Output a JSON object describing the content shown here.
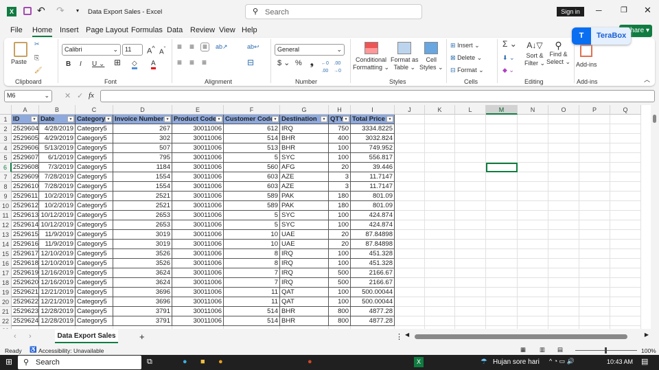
{
  "title": {
    "doc": "Data Export Sales",
    "app": "Excel",
    "search_placeholder": "Search",
    "sign_in": "Sign in"
  },
  "menu": [
    "File",
    "Home",
    "Insert",
    "Page Layout",
    "Formulas",
    "Data",
    "Review",
    "View",
    "Help"
  ],
  "share": "Share",
  "terabox": "TeraBox",
  "ribbon": {
    "paste": "Paste",
    "clipboard": "Clipboard",
    "font_name": "Calibri",
    "font_size": "11",
    "font": "Font",
    "alignment": "Alignment",
    "number_format": "General",
    "number": "Number",
    "conditional": "Conditional",
    "formatting": "Formatting",
    "format_as": "Format as",
    "table": "Table",
    "cell": "Cell",
    "styles_btn": "Styles",
    "styles": "Styles",
    "insert": "Insert",
    "delete": "Delete",
    "format": "Format",
    "cells": "Cells",
    "sort": "Sort &",
    "filter": "Filter",
    "find": "Find &",
    "select": "Select",
    "editing": "Editing",
    "addins": "Add-ins",
    "addins_group": "Add-ins"
  },
  "formula_bar": {
    "name_box": "M6",
    "fx": "fx",
    "value": ""
  },
  "columns": [
    "A",
    "B",
    "C",
    "D",
    "E",
    "F",
    "G",
    "H",
    "I",
    "J",
    "K",
    "L",
    "M",
    "N",
    "O",
    "P",
    "Q"
  ],
  "headers": [
    "ID",
    "Date",
    "Category",
    "Invoice Number",
    "Product Code",
    "Customer Code",
    "Destination",
    "QTY",
    "Total Price"
  ],
  "rows": [
    [
      "2529604",
      "4/28/2019",
      "Category5",
      "267",
      "30011006",
      "612",
      "IRQ",
      "750",
      "3334.8225"
    ],
    [
      "2529605",
      "4/29/2019",
      "Category5",
      "302",
      "30011006",
      "514",
      "BHR",
      "400",
      "3032.824"
    ],
    [
      "2529606",
      "5/13/2019",
      "Category5",
      "507",
      "30011006",
      "513",
      "BHR",
      "100",
      "749.952"
    ],
    [
      "2529607",
      "6/1/2019",
      "Category5",
      "795",
      "30011006",
      "5",
      "SYC",
      "100",
      "556.817"
    ],
    [
      "2529608",
      "7/3/2019",
      "Category5",
      "1184",
      "30011006",
      "560",
      "AFG",
      "20",
      "39.446"
    ],
    [
      "2529609",
      "7/28/2019",
      "Category5",
      "1554",
      "30011006",
      "603",
      "AZE",
      "3",
      "11.7147"
    ],
    [
      "2529610",
      "7/28/2019",
      "Category5",
      "1554",
      "30011006",
      "603",
      "AZE",
      "3",
      "11.7147"
    ],
    [
      "2529611",
      "10/2/2019",
      "Category5",
      "2521",
      "30011006",
      "589",
      "PAK",
      "180",
      "801.09"
    ],
    [
      "2529612",
      "10/2/2019",
      "Category5",
      "2521",
      "30011006",
      "589",
      "PAK",
      "180",
      "801.09"
    ],
    [
      "2529613",
      "10/12/2019",
      "Category5",
      "2653",
      "30011006",
      "5",
      "SYC",
      "100",
      "424.874"
    ],
    [
      "2529614",
      "10/12/2019",
      "Category5",
      "2653",
      "30011006",
      "5",
      "SYC",
      "100",
      "424.874"
    ],
    [
      "2529615",
      "11/9/2019",
      "Category5",
      "3019",
      "30011006",
      "10",
      "UAE",
      "20",
      "87.84898"
    ],
    [
      "2529616",
      "11/9/2019",
      "Category5",
      "3019",
      "30011006",
      "10",
      "UAE",
      "20",
      "87.84898"
    ],
    [
      "2529617",
      "12/10/2019",
      "Category5",
      "3526",
      "30011006",
      "8",
      "IRQ",
      "100",
      "451.328"
    ],
    [
      "2529618",
      "12/10/2019",
      "Category5",
      "3526",
      "30011006",
      "8",
      "IRQ",
      "100",
      "451.328"
    ],
    [
      "2529619",
      "12/16/2019",
      "Category5",
      "3624",
      "30011006",
      "7",
      "IRQ",
      "500",
      "2166.67"
    ],
    [
      "2529620",
      "12/16/2019",
      "Category5",
      "3624",
      "30011006",
      "7",
      "IRQ",
      "500",
      "2166.67"
    ],
    [
      "2529621",
      "12/21/2019",
      "Category5",
      "3696",
      "30011006",
      "11",
      "QAT",
      "100",
      "500.00044"
    ],
    [
      "2529622",
      "12/21/2019",
      "Category5",
      "3696",
      "30011006",
      "11",
      "QAT",
      "100",
      "500.00044"
    ],
    [
      "2529623",
      "12/28/2019",
      "Category5",
      "3791",
      "30011006",
      "514",
      "BHR",
      "800",
      "4877.28"
    ],
    [
      "2529624",
      "12/28/2019",
      "Category5",
      "3791",
      "30011006",
      "514",
      "BHR",
      "800",
      "4877.28"
    ]
  ],
  "sheet_tab": "Data Export Sales",
  "status": {
    "ready": "Ready",
    "accessibility": "Accessibility: Unavailable",
    "zoom": "100%"
  },
  "taskbar": {
    "search": "Search",
    "weather": "Hujan sore hari",
    "time": "10:43 AM"
  }
}
